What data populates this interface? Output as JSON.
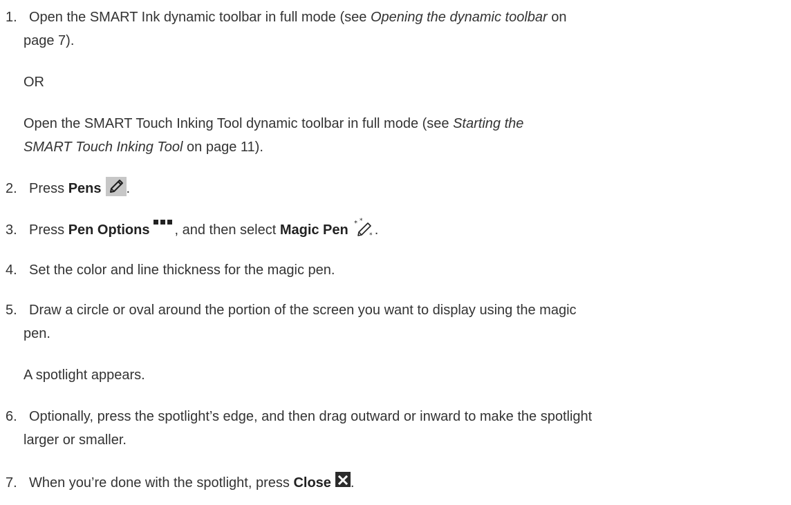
{
  "steps": [
    {
      "number": "1.",
      "line1_pre": "Open the SMART Ink dynamic toolbar in full mode (see ",
      "line1_link": "Opening the dynamic toolbar",
      "line1_post": " on",
      "line2": "page 7).",
      "or_text": "OR",
      "alt_line1_pre": "Open the SMART Touch Inking Tool dynamic toolbar in full mode (see ",
      "alt_line1_link": "Starting the",
      "alt_line2_link": "SMART Touch Inking Tool",
      "alt_line2_post": " on page 11)."
    },
    {
      "number": "2.",
      "pre": "Press ",
      "bold": "Pens",
      "icon": "pen-icon",
      "post": "."
    },
    {
      "number": "3.",
      "pre": "Press ",
      "bold": "Pen Options",
      "icon": "pen-options-icon",
      "middle": ", and then select ",
      "bold2": "Magic Pen",
      "icon2": "magic-pen-icon",
      "post": "."
    },
    {
      "number": "4.",
      "text": "Set the color and line thickness for the magic pen."
    },
    {
      "number": "5.",
      "line1": "Draw a circle or oval around the portion of the screen you want to display using the magic",
      "line2": "pen.",
      "result": "A spotlight appears."
    },
    {
      "number": "6.",
      "line1": "Optionally, press the spotlight’s edge, and then drag outward or inward to make the spotlight",
      "line2": "larger or smaller."
    },
    {
      "number": "7.",
      "pre": "When you’re done with the spotlight, press ",
      "bold": "Close",
      "icon": "close-icon",
      "post": "."
    }
  ]
}
